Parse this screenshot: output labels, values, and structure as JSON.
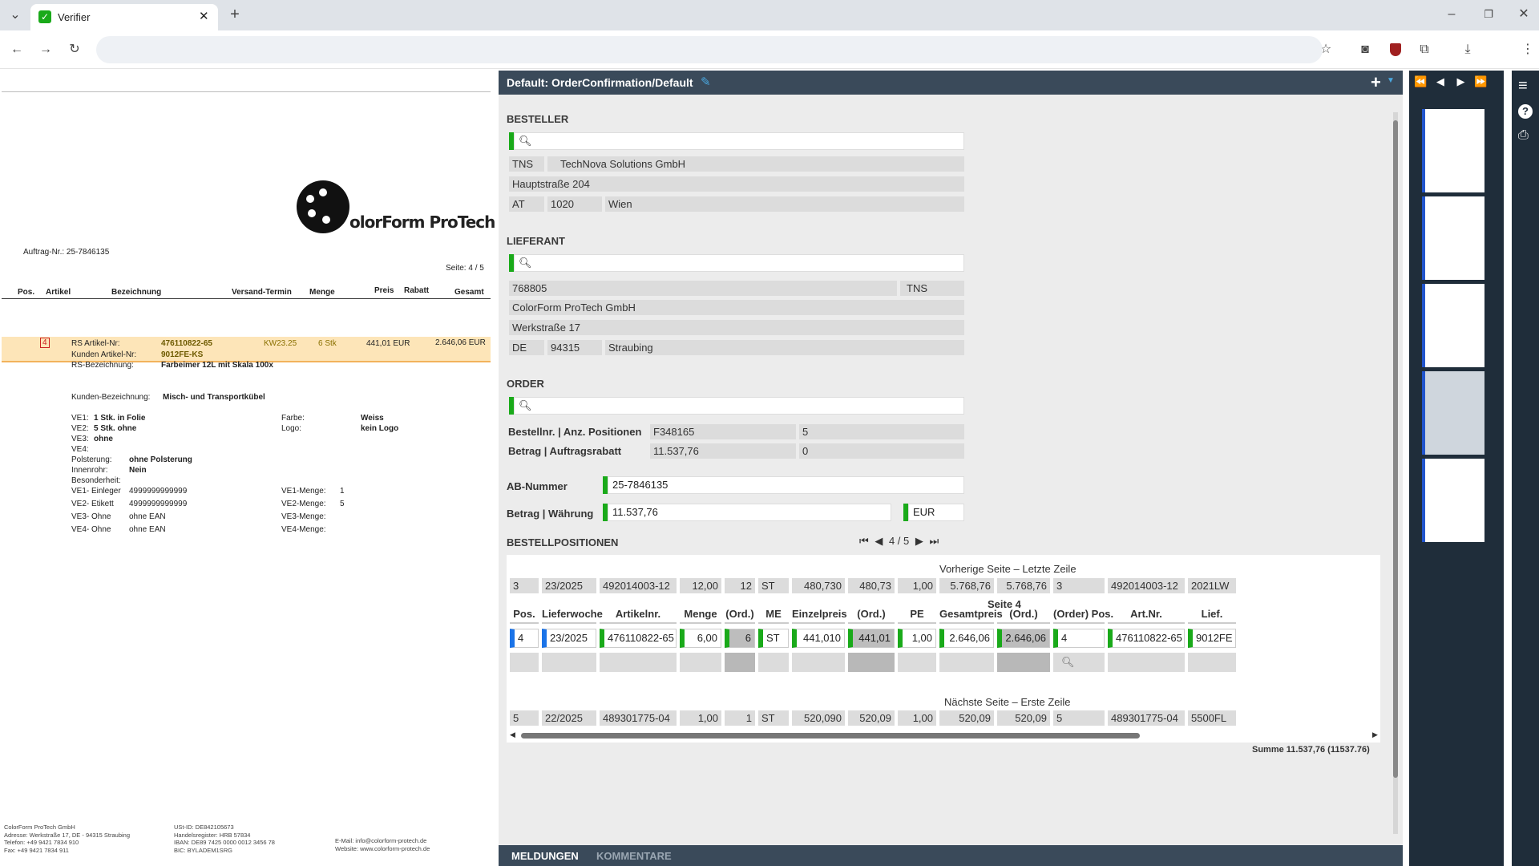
{
  "browser": {
    "tab_title": "Verifier"
  },
  "doc": {
    "logo_text": "olorForm ProTech",
    "order_no": "Auftrag-Nr.: 25-7846135",
    "page": "Seite: 4 / 5",
    "cols": [
      "Pos.",
      "Artikel",
      "Bezeichnung",
      "Versand-Termin",
      "Menge",
      "Preis",
      "Rabatt",
      "Gesamt"
    ],
    "pos": "4",
    "rs_label": "RS Artikel-Nr:",
    "rs_value": "476110822-65",
    "kunden_label": "Kunden  Artikel-Nr:",
    "kunden_value": "9012FE-KS",
    "kw": "KW23.25",
    "qty": "6  Stk",
    "price": "441,01  EUR",
    "total": "2.646,06  EUR",
    "rsbez_label": "RS-Bezeichnung:",
    "rsbez_value": "Farbeimer 12L mit Skala 100x",
    "kbez_label": "Kunden-Bezeichnung:",
    "kbez_value": "Misch- und Transportkübel",
    "attrs": [
      {
        "k": "VE1:",
        "v": "1 Stk. in Folie"
      },
      {
        "k": "VE2:",
        "v": "5 Stk.  ohne"
      },
      {
        "k": "VE3:",
        "v": "ohne"
      },
      {
        "k": "VE4:",
        "v": ""
      },
      {
        "k": "Polsterung:",
        "v": "ohne Polsterung"
      },
      {
        "k": "Innenrohr:",
        "v": "Nein"
      },
      {
        "k": "Besonderheit:",
        "v": ""
      },
      {
        "k": "VE1- Einleger",
        "v": "4999999999999"
      },
      {
        "k": "VE2- Etikett",
        "v": "4999999999999"
      },
      {
        "k": "VE3- Ohne",
        "v": "ohne EAN"
      },
      {
        "k": "VE4- Ohne",
        "v": "ohne EAN"
      }
    ],
    "farbe_label": "Farbe:",
    "farbe_value": "Weiss",
    "logo_label": "Logo:",
    "logo_value": "kein Logo",
    "menge": [
      {
        "k": "VE1-Menge:",
        "v": "1"
      },
      {
        "k": "VE2-Menge:",
        "v": "5"
      },
      {
        "k": "VE3-Menge:",
        "v": ""
      },
      {
        "k": "VE4-Menge:",
        "v": ""
      }
    ],
    "footer1": [
      "ColorForm ProTech GmbH",
      "Adresse: Werkstraße 17, DE - 94315 Straubing",
      "Telefon: +49 9421 7834 910",
      "Fax: +49 9421 7834 911"
    ],
    "footer2": [
      "USt-ID: DE842105673",
      "Handelsregister: HRB 57834",
      "IBAN: DE89 7425 0000 0012 3456 78",
      "BIC: BYLADEM1SRG"
    ],
    "footer3": [
      "E-Mail: info@colorform-protech.de",
      "Website: www.colorform-protech.de"
    ]
  },
  "panel": {
    "title": "Default: OrderConfirmation/Default",
    "besteller": {
      "label": "BESTELLER",
      "code": "TNS",
      "name": "TechNova Solutions GmbH",
      "street": "Hauptstraße 204",
      "country": "AT",
      "zip": "1020",
      "city": "Wien"
    },
    "lieferant": {
      "label": "LIEFERANT",
      "number": "768805",
      "code": "TNS",
      "name": "ColorForm ProTech GmbH",
      "street": "Werkstraße 17",
      "country": "DE",
      "zip": "94315",
      "city": "Straubing"
    },
    "order": {
      "label": "ORDER",
      "l1": "Bestellnr. | Anz. Positionen",
      "v1a": "F348165",
      "v1b": "5",
      "l2": "Betrag | Auftragsrabatt",
      "v2a": "11.537,76",
      "v2b": "0",
      "ab_label": "AB-Nummer",
      "ab_value": "25-7846135",
      "bw_label": "Betrag | Währung",
      "bw_value": "11.537,76",
      "currency": "EUR"
    },
    "pos": {
      "label": "BESTELLPOSITIONEN",
      "pager": "4 / 5",
      "prev_label": "Vorherige Seite – Letzte Zeile",
      "prev_row": [
        "3",
        "23/2025",
        "492014003-12",
        "12,00",
        "12",
        "ST",
        "480,730",
        "480,73",
        "1,00",
        "5.768,76",
        "5.768,76",
        "3",
        "492014003-12",
        "2021LW"
      ],
      "page_label": "Seite 4",
      "headers": [
        "Pos.",
        "Lieferwoche",
        "Artikelnr.",
        "Menge",
        "(Ord.)",
        "ME",
        "Einzelpreis",
        "(Ord.)",
        "PE",
        "Gesamtpreis",
        "(Ord.)",
        "(Order) Pos.",
        "Art.Nr.",
        "Lief."
      ],
      "cur_row": [
        "4",
        "23/2025",
        "476110822-65",
        "6,00",
        "6",
        "ST",
        "441,010",
        "441,01",
        "1,00",
        "2.646,06",
        "2.646,06",
        "4",
        "476110822-65",
        "9012FE"
      ],
      "next_label": "Nächste Seite – Erste Zeile",
      "next_row": [
        "5",
        "22/2025",
        "489301775-04",
        "1,00",
        "1",
        "ST",
        "520,090",
        "520,09",
        "1,00",
        "520,09",
        "520,09",
        "5",
        "489301775-04",
        "5500FL"
      ],
      "summe": "Summe 11.537,76 (11537.76)"
    },
    "tabs": [
      "MELDUNGEN",
      "KOMMENTARE"
    ]
  }
}
